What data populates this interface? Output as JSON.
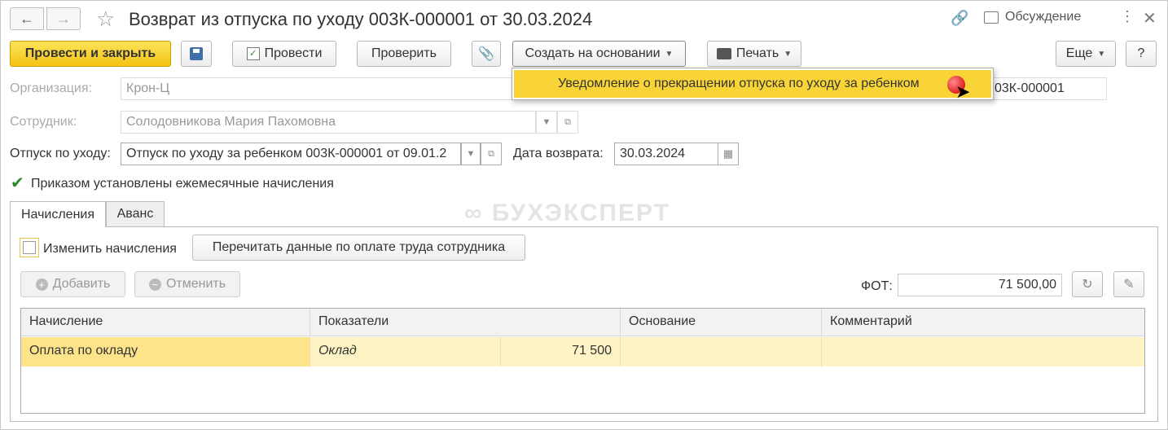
{
  "window": {
    "title": "Возврат из отпуска по уходу 003К-000001 от 30.03.2024",
    "discussion_label": "Обсуждение"
  },
  "toolbar": {
    "post_close": "Провести и закрыть",
    "post": "Провести",
    "check": "Проверить",
    "create_based": "Создать на основании",
    "print": "Печать",
    "more": "Еще",
    "help": "?"
  },
  "dropdown": {
    "items": [
      "Уведомление о прекращении отпуска по уходу за ребенком"
    ]
  },
  "form": {
    "organization_label": "Организация:",
    "organization_value": "Крон-Ц",
    "number_value": "03К-000001",
    "employee_label": "Сотрудник:",
    "employee_value": "Солодовникова Мария Пахомовна",
    "leave_label": "Отпуск по уходу:",
    "leave_value": "Отпуск по уходу за ребенком 003К-000001 от 09.01.2",
    "return_date_label": "Дата возврата:",
    "return_date_value": "30.03.2024",
    "monthly_accruals_label": "Приказом установлены ежемесячные начисления",
    "monthly_accruals_checked": true
  },
  "watermark": "БУХЭКСПЕРТ",
  "tabs": [
    {
      "label": "Начисления",
      "active": true
    },
    {
      "label": "Аванс",
      "active": false
    }
  ],
  "accruals": {
    "change_label": "Изменить начисления",
    "change_checked": false,
    "reread_button": "Перечитать данные по оплате труда сотрудника",
    "add_button": "Добавить",
    "cancel_button": "Отменить",
    "fot_label": "ФОТ:",
    "fot_value": "71 500,00"
  },
  "grid": {
    "columns": [
      "Начисление",
      "Показатели",
      "Основание",
      "Комментарий"
    ],
    "rows": [
      {
        "accrual": "Оплата по окладу",
        "indicator": "Оклад",
        "indicator_value": "71 500",
        "basis": "",
        "comment": ""
      }
    ]
  },
  "colors": {
    "primary_button": "#f4c315",
    "dropdown_highlight": "#f9d437",
    "row_selected": "#fde48a",
    "row_bg": "#fdf3c5"
  }
}
